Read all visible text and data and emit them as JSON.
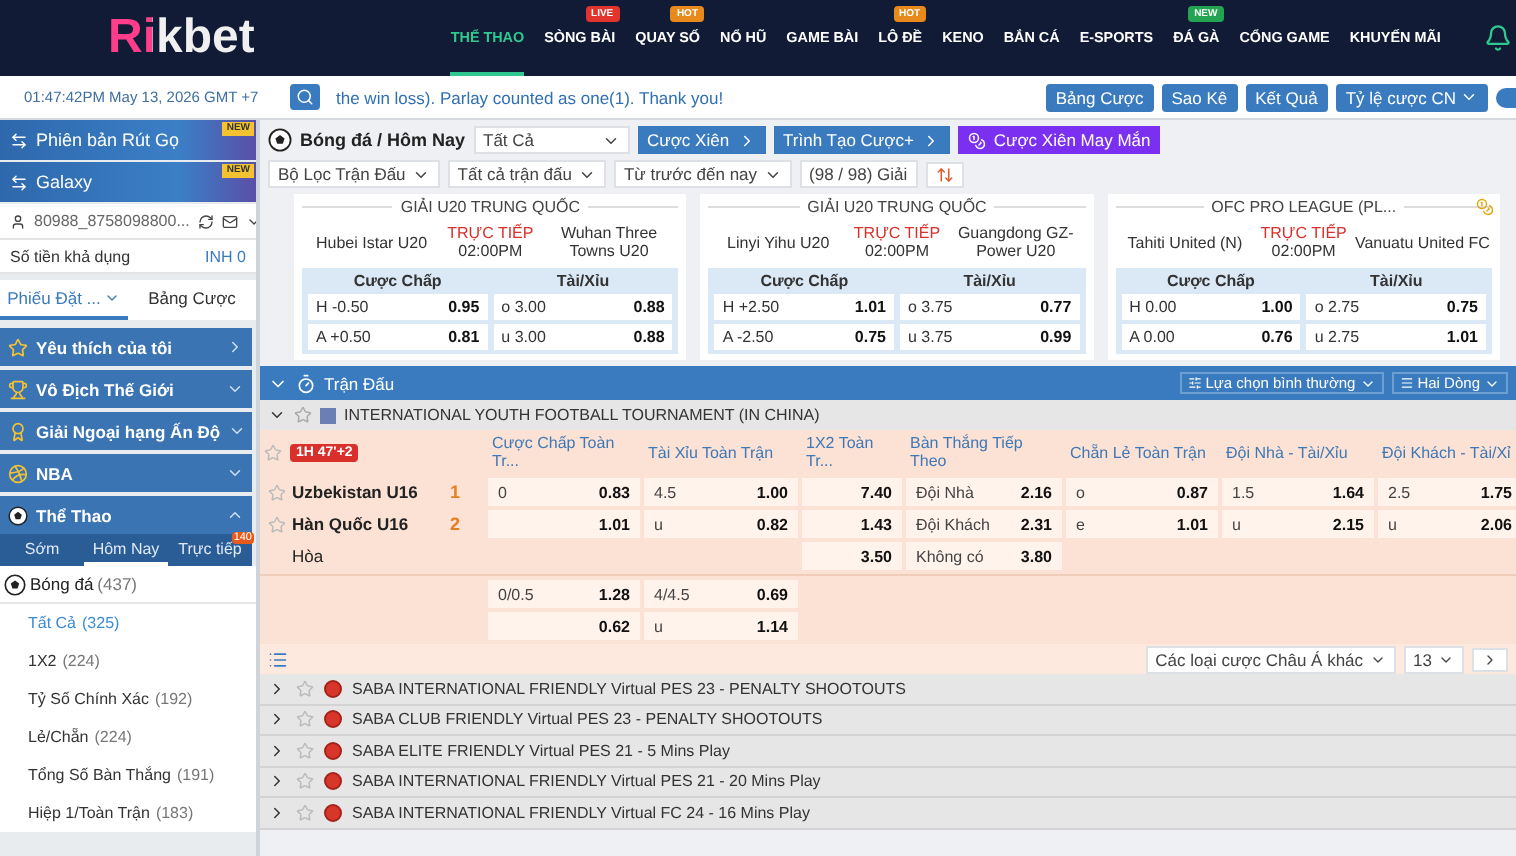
{
  "header": {
    "logo": "Rikbet",
    "nav": [
      {
        "label": "THỂ THAO",
        "selected": true
      },
      {
        "label": "SÒNG BÀI",
        "selected": false,
        "badge": {
          "text": "LIVE",
          "color": "#e0342c"
        }
      },
      {
        "label": "QUAY SỐ",
        "selected": false,
        "badge": {
          "text": "HOT",
          "color": "#e8891c"
        }
      },
      {
        "label": "NỔ HŨ",
        "selected": false
      },
      {
        "label": "GAME BÀI",
        "selected": false
      },
      {
        "label": "LÔ ĐỀ",
        "selected": false,
        "badge": {
          "text": "HOT",
          "color": "#e8891c"
        }
      },
      {
        "label": "KENO",
        "selected": false
      },
      {
        "label": "BẮN CÁ",
        "selected": false
      },
      {
        "label": "E-SPORTS",
        "selected": false
      },
      {
        "label": "ĐÁ GÀ",
        "selected": false,
        "badge": {
          "text": "NEW",
          "color": "#23a453"
        }
      },
      {
        "label": "CỔNG GAME",
        "selected": false
      },
      {
        "label": "KHUYẾN MÃI",
        "selected": false
      }
    ]
  },
  "subbar": {
    "clock": "01:47:42PM May 13, 2026 GMT +7",
    "ticker": "the win loss). Parlay counted as one(1). Thank you!",
    "buttons": [
      "Bảng Cược",
      "Sao Kê",
      "Kết Quả"
    ],
    "odds_select": "Tỷ lệ cược CN",
    "toggle": {
      "on": true
    }
  },
  "sidebar": {
    "banners": [
      {
        "label": "Phiên bản Rút Gọ",
        "ribbon": "NEW"
      },
      {
        "label": "Galaxy",
        "ribbon": "NEW"
      }
    ],
    "account": {
      "user": "80988_8758098800...",
      "balance_label": "Số tiền khả dụng",
      "balance": "INH 0"
    },
    "slip_tabs": [
      {
        "label": "Phiếu Đặt ...",
        "selected": true
      },
      {
        "label": "Bảng Cược",
        "selected": false
      }
    ],
    "sections": [
      {
        "label": "Yêu thích của tôi",
        "kind": "link",
        "expanded": false
      },
      {
        "label": "Vô Địch Thế Giới",
        "kind": "group",
        "expanded": false
      },
      {
        "label": "Giải Ngoại hạng Ấn Độ",
        "kind": "group",
        "expanded": false
      },
      {
        "label": "NBA",
        "kind": "group",
        "expanded": false
      },
      {
        "label": "Thể Thao",
        "kind": "group",
        "expanded": true
      }
    ],
    "sport_tabs": [
      {
        "label": "Sớm",
        "selected": false
      },
      {
        "label": "Hôm Nay",
        "selected": true
      },
      {
        "label": "Trực tiếp",
        "selected": false,
        "badge": "140"
      }
    ],
    "sport": {
      "label": "Bóng đá",
      "count": "(437)"
    },
    "bet_types": [
      {
        "label": "Tất Cả",
        "count": "(325)",
        "selected": true
      },
      {
        "label": "1X2",
        "count": "(224)",
        "selected": false
      },
      {
        "label": "Tỷ Số Chính Xác",
        "count": "(192)",
        "selected": false
      },
      {
        "label": "Lẻ/Chẵn",
        "count": "(224)",
        "selected": false
      },
      {
        "label": "Tổng Số Bàn Thắng",
        "count": "(191)",
        "selected": false
      },
      {
        "label": "Hiệp 1/Toàn Trận",
        "count": "(183)",
        "selected": false
      }
    ]
  },
  "toolbar": {
    "breadcrumb": "Bóng đá / Hôm Nay",
    "market_select": "Tất Cả",
    "buttons": [
      {
        "label": "Cược Xiên",
        "kind": "nav"
      },
      {
        "label": "Trình Tạo Cược+",
        "kind": "nav"
      },
      {
        "label": "Cược Xiên May Mắn",
        "kind": "lucky"
      }
    ],
    "filters": [
      {
        "label": "Bộ Lọc Trận Đấu",
        "kind": "dropdown"
      },
      {
        "label": "Tất cả trận đấu",
        "kind": "dropdown"
      },
      {
        "label": "Từ trước đến nay",
        "kind": "dropdown"
      },
      {
        "label": "(98 / 98) Giải",
        "kind": "plain"
      }
    ]
  },
  "featured": [
    {
      "league": "GIẢI U20 TRUNG QUỐC",
      "home": "Hubei Istar U20",
      "status": "TRỰC TIẾP",
      "time": "02:00PM",
      "away": "Wuhan Three Towns U20",
      "cashout": false,
      "headings": [
        "Cược Chấp",
        "Tài/Xỉu"
      ],
      "handicap": [
        {
          "side": "H",
          "line": "-0.50",
          "odds": "0.95"
        },
        {
          "side": "A",
          "line": "+0.50",
          "odds": "0.81"
        }
      ],
      "totals": [
        {
          "side": "o",
          "line": "3.00",
          "odds": "0.88"
        },
        {
          "side": "u",
          "line": "3.00",
          "odds": "0.88"
        }
      ]
    },
    {
      "league": "GIẢI U20 TRUNG QUỐC",
      "home": "Linyi Yihu U20",
      "status": "TRỰC TIẾP",
      "time": "02:00PM",
      "away": "Guangdong GZ-Power U20",
      "cashout": false,
      "headings": [
        "Cược Chấp",
        "Tài/Xỉu"
      ],
      "handicap": [
        {
          "side": "H",
          "line": "+2.50",
          "odds": "1.01"
        },
        {
          "side": "A",
          "line": "-2.50",
          "odds": "0.75"
        }
      ],
      "totals": [
        {
          "side": "o",
          "line": "3.75",
          "odds": "0.77"
        },
        {
          "side": "u",
          "line": "3.75",
          "odds": "0.99"
        }
      ]
    },
    {
      "league": "OFC PRO LEAGUE (PL...",
      "home": "Tahiti United (N)",
      "status": "TRỰC TIẾP",
      "time": "02:00PM",
      "away": "Vanuatu United FC",
      "cashout": true,
      "headings": [
        "Cược Chấp",
        "Tài/Xỉu"
      ],
      "handicap": [
        {
          "side": "H",
          "line": "0.00",
          "odds": "1.00"
        },
        {
          "side": "A",
          "line": "0.00",
          "odds": "0.76"
        }
      ],
      "totals": [
        {
          "side": "o",
          "line": "2.75",
          "odds": "0.75"
        },
        {
          "side": "u",
          "line": "2.75",
          "odds": "1.01"
        }
      ]
    }
  ],
  "match_table": {
    "title": "Trận Đấu",
    "view_select": "Lựa chọn bình thường",
    "rows_select": "Hai Dòng",
    "league": "INTERNATIONAL YOUTH FOOTBALL TOURNAMENT (IN CHINA)",
    "live": "1H 47'+2",
    "columns": [
      "Cược Chấp Toàn Tr...",
      "Tài Xỉu Toàn Trận",
      "1X2 Toàn Tr...",
      "Bàn Thắng Tiếp Theo",
      "Chẵn Lẻ Toàn Trận",
      "Đội Nhà - Tài/Xỉu",
      "Đội Khách - Tài/Xỉ"
    ],
    "lines": [
      {
        "team": {
          "name": "Uzbekistan U16",
          "score": "1"
        },
        "cells": [
          {
            "label": "0",
            "odds": "0.83"
          },
          {
            "label": "4.5",
            "odds": "1.00"
          },
          {
            "odds": "7.40"
          },
          {
            "label": "Đội Nhà",
            "odds": "2.16"
          },
          {
            "label": "o",
            "odds": "0.87"
          },
          {
            "label": "1.5",
            "odds": "1.64"
          },
          {
            "label": "2.5",
            "odds": "1.75"
          }
        ]
      },
      {
        "team": {
          "name": "Hàn Quốc U16",
          "score": "2"
        },
        "cells": [
          {
            "odds": "1.01"
          },
          {
            "label": "u",
            "odds": "0.82"
          },
          {
            "odds": "1.43"
          },
          {
            "label": "Đội Khách",
            "odds": "2.31"
          },
          {
            "label": "e",
            "odds": "1.01"
          },
          {
            "label": "u",
            "odds": "2.15"
          },
          {
            "label": "u",
            "odds": "2.06"
          }
        ]
      },
      {
        "team": {
          "name": "Hòa",
          "kind": "draw"
        },
        "cells": [
          null,
          null,
          {
            "odds": "3.50"
          },
          {
            "label": "Không có",
            "odds": "3.80"
          },
          null,
          null,
          null
        ]
      },
      {
        "cells": [
          {
            "label": "0/0.5",
            "odds": "1.28"
          },
          {
            "label": "4/4.5",
            "odds": "0.69"
          },
          null,
          null,
          null,
          null,
          null
        ]
      },
      {
        "cells": [
          {
            "odds": "0.62"
          },
          {
            "label": "u",
            "odds": "1.14"
          },
          null,
          null,
          null,
          null,
          null
        ]
      }
    ],
    "more_select": "Các loại cược Châu Á khác",
    "page_size": "13"
  },
  "leagues": [
    "SABA INTERNATIONAL FRIENDLY Virtual PES 23 - PENALTY SHOOTOUTS",
    "SABA CLUB FRIENDLY Virtual PES 23 - PENALTY SHOOTOUTS",
    "SABA ELITE FRIENDLY Virtual PES 21 - 5 Mins Play",
    "SABA INTERNATIONAL FRIENDLY Virtual PES 21 - 20 Mins Play",
    "SABA INTERNATIONAL FRIENDLY Virtual FC 24 - 16 Mins Play"
  ]
}
